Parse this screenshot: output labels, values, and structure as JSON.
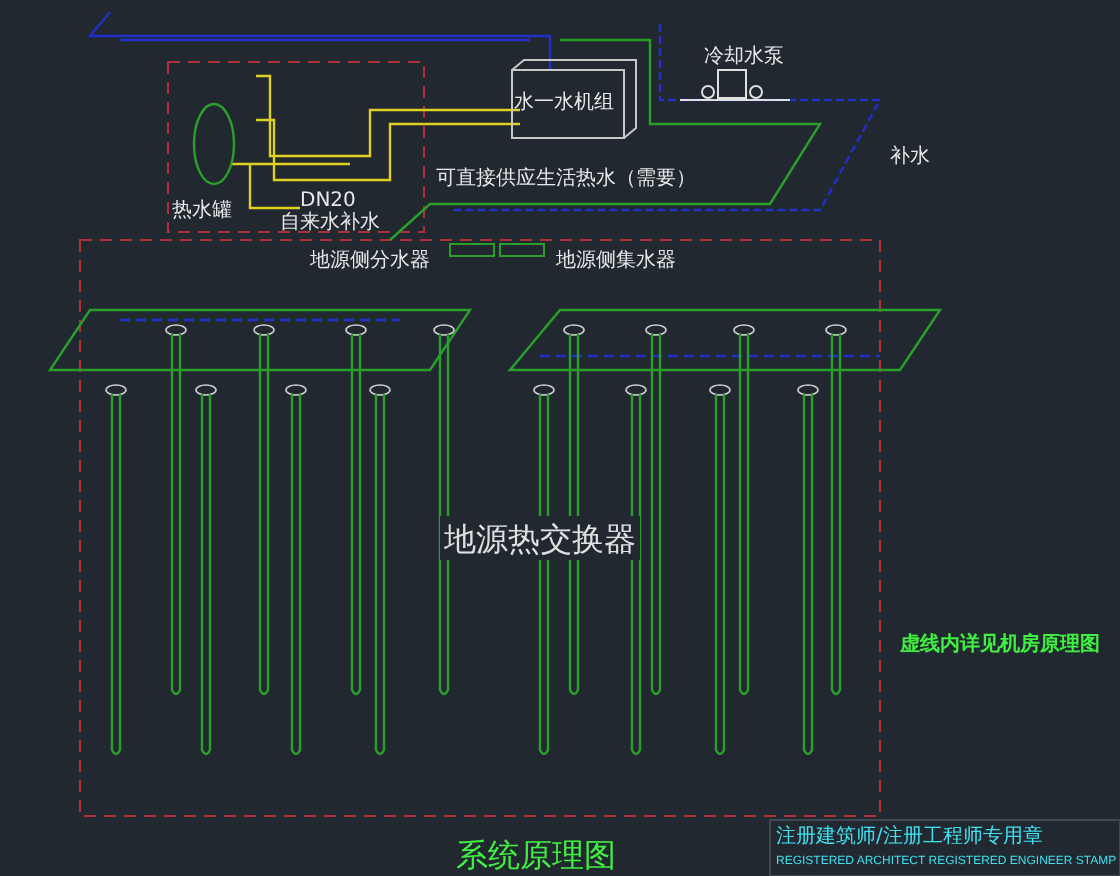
{
  "machine_room": {
    "unit_label": "水一水机组",
    "tank_label": "热水罐",
    "pipe_size": "DN20",
    "tap_water_label": "自来水补水",
    "hot_water_note": "可直接供应生活热水（需要）"
  },
  "cooling": {
    "pump_label": "冷却水泵",
    "makeup_label": "补水"
  },
  "manifolds": {
    "supply_label": "地源侧分水器",
    "return_label": "地源侧集水器"
  },
  "field_label": "地源热交换器",
  "note": "虚线内详见机房原理图",
  "stamp": {
    "line_1": "注册建筑师/注册工程师专用章",
    "line_2": "REGISTERED ARCHITECT REGISTERED ENGINEER STAMP"
  },
  "title": "系统原理图"
}
